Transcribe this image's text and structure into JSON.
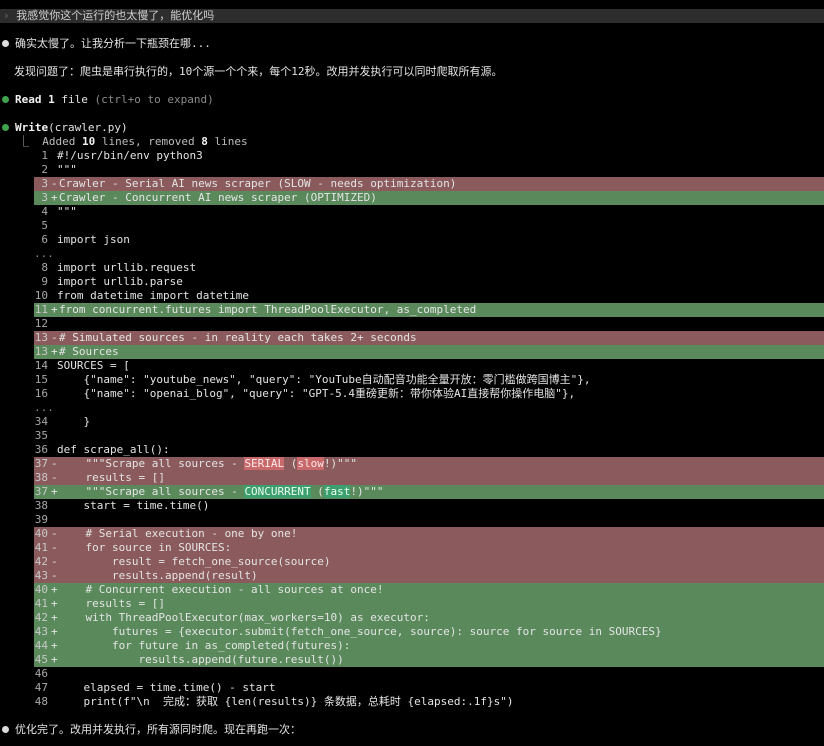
{
  "prompt": {
    "chevron": "›",
    "text": "我感觉你这个运行的也太慢了，能优化吗"
  },
  "assistant": {
    "intro": "确实太慢了。让我分析一下瓶颈在哪...",
    "finding": "发现问题了：爬虫是串行执行的，10个源一个个来，每个12秒。改用并发执行可以同时爬取所有源。",
    "outro": "优化完了。改用并发执行，所有源同时爬。现在再跑一次："
  },
  "read_tool": {
    "name": "Read",
    "count": "1",
    "unit": "file",
    "hint": "(ctrl+o to expand)"
  },
  "write_tool": {
    "name": "Write",
    "arg": "(crawler.py)",
    "summary_prefix": "Added ",
    "added": "10",
    "summary_mid": " lines, removed ",
    "removed": "8",
    "summary_suffix": " lines"
  },
  "diff": {
    "ellipsis": "...",
    "lines": [
      {
        "n": "1",
        "s": "",
        "t": "#!/usr/bin/env python3",
        "k": "ctx"
      },
      {
        "n": "2",
        "s": "",
        "t": "\"\"\"",
        "k": "ctx"
      },
      {
        "n": "3",
        "s": "-",
        "t": "Crawler - Serial AI news scraper (SLOW - needs optimization)",
        "k": "del"
      },
      {
        "n": "3",
        "s": "+",
        "t": "Crawler - Concurrent AI news scraper (OPTIMIZED)",
        "k": "add"
      },
      {
        "n": "4",
        "s": "",
        "t": "\"\"\"",
        "k": "ctx"
      },
      {
        "n": "5",
        "s": "",
        "t": "",
        "k": "ctx"
      },
      {
        "n": "6",
        "s": "",
        "t": "import json",
        "k": "ctx"
      },
      {
        "k": "gap"
      },
      {
        "n": "8",
        "s": "",
        "t": "import urllib.request",
        "k": "ctx"
      },
      {
        "n": "9",
        "s": "",
        "t": "import urllib.parse",
        "k": "ctx"
      },
      {
        "n": "10",
        "s": "",
        "t": "from datetime import datetime",
        "k": "ctx"
      },
      {
        "n": "11",
        "s": "+",
        "t": "from concurrent.futures import ThreadPoolExecutor, as_completed",
        "k": "add"
      },
      {
        "n": "12",
        "s": "",
        "t": "",
        "k": "ctx"
      },
      {
        "n": "13",
        "s": "-",
        "t": "# Simulated sources - in reality each takes 2+ seconds",
        "k": "del"
      },
      {
        "n": "13",
        "s": "+",
        "t": "# Sources",
        "k": "add"
      },
      {
        "n": "14",
        "s": "",
        "t": "SOURCES = [",
        "k": "ctx"
      },
      {
        "n": "15",
        "s": "",
        "t": "    {\"name\": \"youtube_news\", \"query\": \"YouTube自动配音功能全量开放：零门槛做跨国博主\"},",
        "k": "ctx"
      },
      {
        "n": "16",
        "s": "",
        "t": "    {\"name\": \"openai_blog\", \"query\": \"GPT-5.4重磅更新：带你体验AI直接帮你操作电脑\"},",
        "k": "ctx"
      },
      {
        "k": "gap"
      },
      {
        "n": "34",
        "s": "",
        "t": "    }",
        "k": "ctx"
      },
      {
        "n": "35",
        "s": "",
        "t": "",
        "k": "ctx"
      },
      {
        "n": "36",
        "s": "",
        "t": "def scrape_all():",
        "k": "ctx"
      },
      {
        "n": "37",
        "s": "-",
        "t": "    \"\"\"Scrape all sources - ",
        "h": "SERIAL",
        "m": " (",
        "h2": "slow",
        "e": "!)\"\"\"",
        "k": "del"
      },
      {
        "n": "38",
        "s": "-",
        "t": "    results = []",
        "k": "del"
      },
      {
        "n": "37",
        "s": "+",
        "t": "    \"\"\"Scrape all sources - ",
        "h": "CONCURRENT",
        "m": " (",
        "h2": "fast",
        "e": "!)\"\"\"",
        "k": "add"
      },
      {
        "n": "38",
        "s": "",
        "t": "    start = time.time()",
        "k": "ctx"
      },
      {
        "n": "39",
        "s": "",
        "t": "",
        "k": "ctx"
      },
      {
        "n": "40",
        "s": "-",
        "t": "    # Serial execution - one by one!",
        "k": "del"
      },
      {
        "n": "41",
        "s": "-",
        "t": "    for source in SOURCES:",
        "k": "del"
      },
      {
        "n": "42",
        "s": "-",
        "t": "        result = fetch_one_source(source)",
        "k": "del"
      },
      {
        "n": "43",
        "s": "-",
        "t": "        results.append(result)",
        "k": "del"
      },
      {
        "n": "40",
        "s": "+",
        "t": "    # Concurrent execution - all sources at once!",
        "k": "add"
      },
      {
        "n": "41",
        "s": "+",
        "t": "    results = []",
        "k": "add"
      },
      {
        "n": "42",
        "s": "+",
        "t": "    with ThreadPoolExecutor(max_workers=10) as executor:",
        "k": "add"
      },
      {
        "n": "43",
        "s": "+",
        "t": "        futures = {executor.submit(fetch_one_source, source): source for source in SOURCES}",
        "k": "add"
      },
      {
        "n": "44",
        "s": "+",
        "t": "        for future in as_completed(futures):",
        "k": "add"
      },
      {
        "n": "45",
        "s": "+",
        "t": "            results.append(future.result())",
        "k": "add"
      },
      {
        "n": "46",
        "s": "",
        "t": "",
        "k": "ctx"
      },
      {
        "n": "47",
        "s": "",
        "t": "    elapsed = time.time() - start",
        "k": "ctx"
      },
      {
        "n": "48",
        "s": "",
        "t": "    print(f\"\\n  完成：获取 {len(results)} 条数据，总耗时 {elapsed:.1f}s\")",
        "k": "ctx"
      }
    ]
  },
  "colors": {
    "deletion_bg": "#8a5a5c",
    "addition_bg": "#5a8a5c",
    "bullet_green": "#3fa34d"
  }
}
